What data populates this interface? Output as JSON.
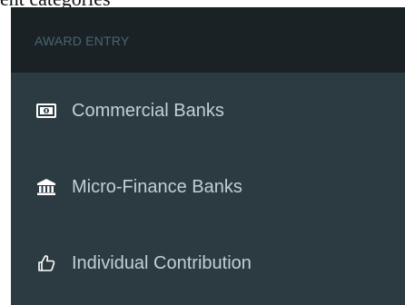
{
  "top_fragment": "ent categories",
  "sidebar": {
    "section_header": "AWARD ENTRY",
    "items": [
      {
        "label": "Commercial Banks",
        "icon": "money-icon"
      },
      {
        "label": "Micro-Finance Banks",
        "icon": "bank-icon"
      },
      {
        "label": "Individual Contribution",
        "icon": "thumbs-up-icon"
      }
    ]
  },
  "colors": {
    "sidebar_bg": "#2c3b41",
    "header_bg": "#1a2226",
    "header_text": "#4b646f",
    "item_text": "#c2cfd6"
  }
}
